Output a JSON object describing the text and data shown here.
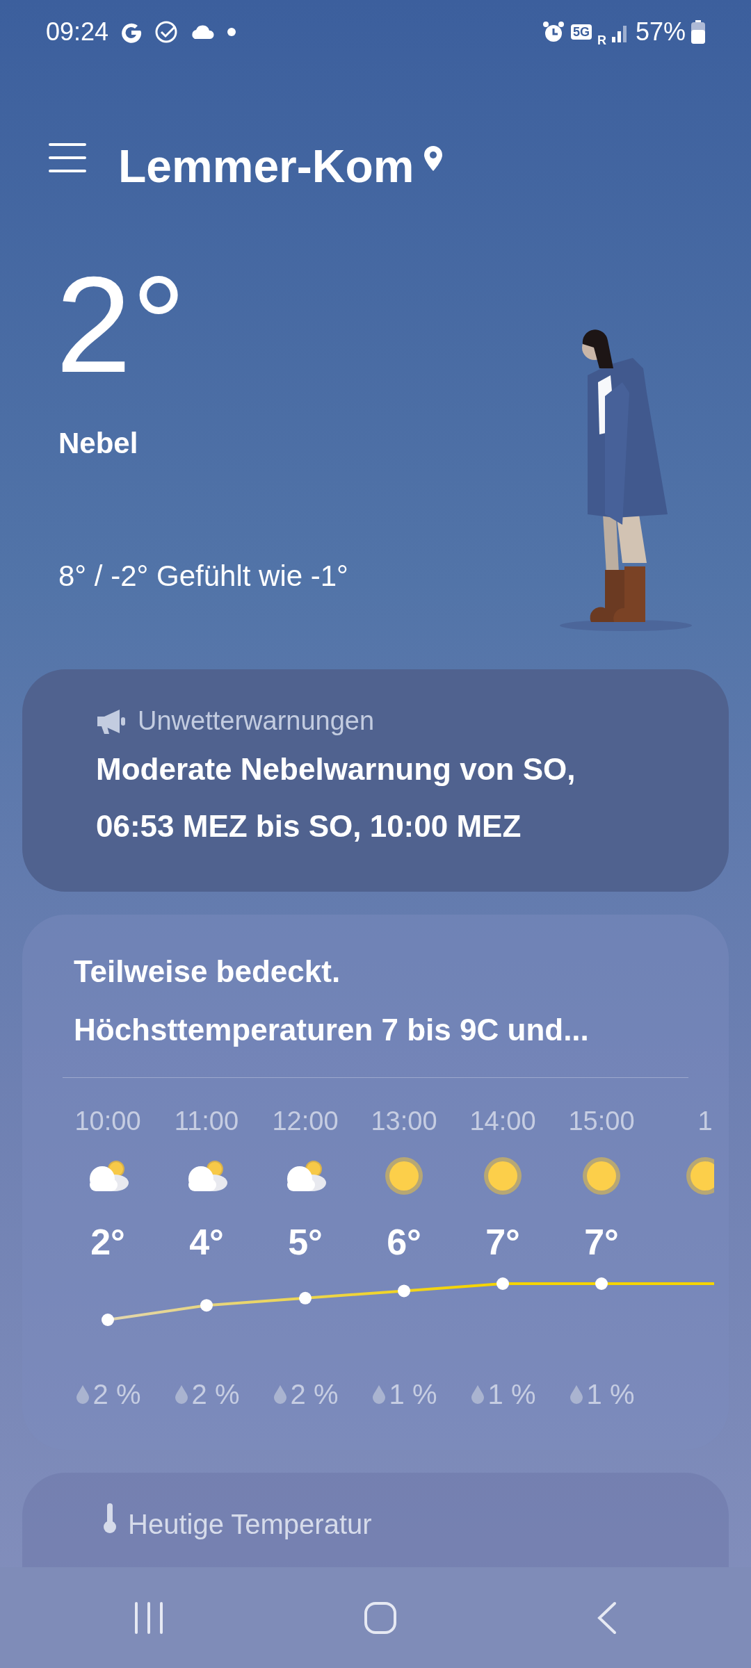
{
  "status_bar": {
    "time": "09:24",
    "network": "5G",
    "roaming": "R",
    "battery": "57%"
  },
  "header": {
    "location": "Lemmer-Kom"
  },
  "current": {
    "temperature": "2°",
    "condition": "Nebel",
    "range": "8° / -2° Gefühlt wie -1°"
  },
  "warning": {
    "title": "Unwetterwarnungen",
    "text": [
      "Moderate Nebelwarnung von SO,",
      "06:53 MEZ bis SO, 10:00 MEZ"
    ]
  },
  "forecast": {
    "summary": [
      "Teilweise bedeckt.",
      "Höchsttemperaturen 7 bis 9C und..."
    ],
    "hours": [
      {
        "time": "10:00",
        "kind": "partly_cloudy",
        "temperature": "2°",
        "precipitation": "2 %"
      },
      {
        "time": "11:00",
        "kind": "partly_cloudy",
        "temperature": "4°",
        "precipitation": "2 %"
      },
      {
        "time": "12:00",
        "kind": "partly_cloudy",
        "temperature": "5°",
        "precipitation": "2 %"
      },
      {
        "time": "13:00",
        "kind": "sunny",
        "temperature": "6°",
        "precipitation": "1 %"
      },
      {
        "time": "14:00",
        "kind": "sunny",
        "temperature": "7°",
        "precipitation": "1 %"
      },
      {
        "time": "15:00",
        "kind": "sunny",
        "temperature": "7°",
        "precipitation": "1 %"
      },
      {
        "time": "1",
        "kind": "sunny"
      }
    ]
  },
  "today_card": {
    "title": "Heutige Temperatur"
  }
}
